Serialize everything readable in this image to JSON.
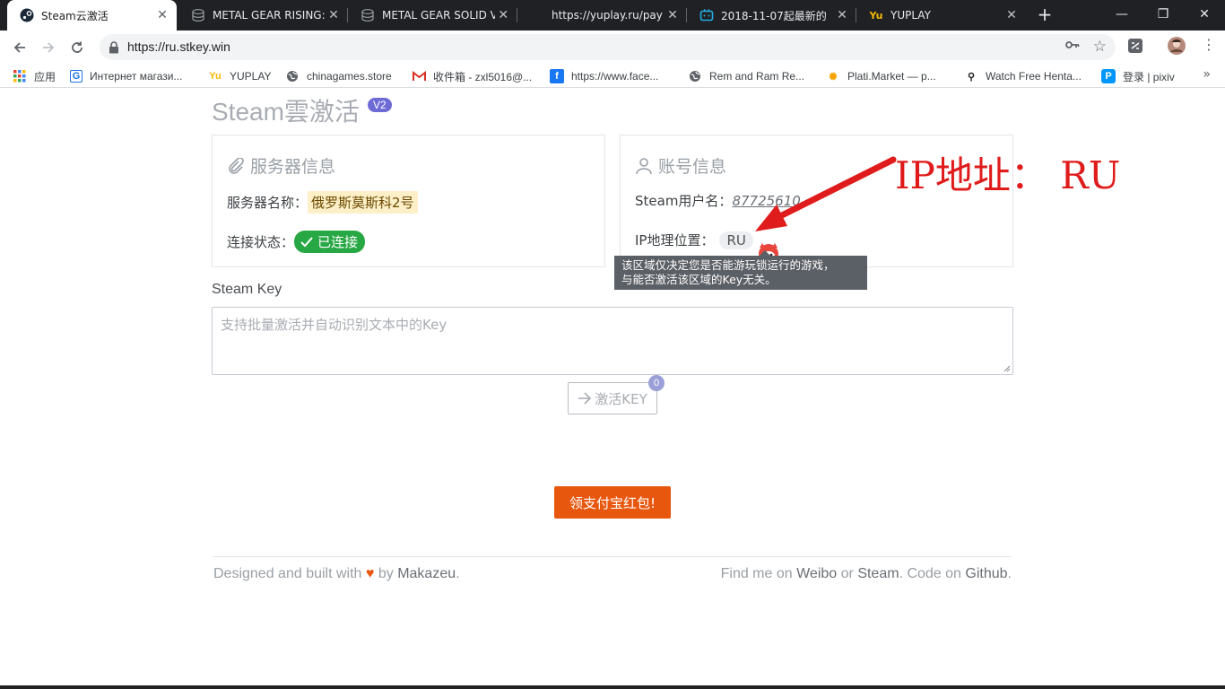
{
  "browser": {
    "tabs": [
      {
        "title": "Steam云激活",
        "active": true,
        "icon": "steam-icon"
      },
      {
        "title": "METAL GEAR RISING:",
        "active": false,
        "icon": "stack-icon"
      },
      {
        "title": "METAL GEAR SOLID V",
        "active": false,
        "icon": "stack-icon"
      },
      {
        "title": "https://yuplay.ru/pay",
        "active": false,
        "icon": "none"
      },
      {
        "title": "2018-11-07起最新的",
        "active": false,
        "icon": "bilibili-icon"
      },
      {
        "title": "YUPLAY",
        "active": false,
        "icon": "yuplay-icon"
      }
    ],
    "close_glyph": "✕",
    "new_tab_glyph": "+",
    "window_controls": {
      "minimize": "—",
      "maximize": "❐",
      "close": "✕"
    },
    "url": "https://ru.stkey.win",
    "bookmarks": [
      {
        "label": "应用",
        "icon": "apps-icon"
      },
      {
        "label": "Интернет магази...",
        "icon": "g-icon"
      },
      {
        "label": "YUPLAY",
        "icon": "yuplay-icon"
      },
      {
        "label": "chinagames.store",
        "icon": "globe-icon"
      },
      {
        "label": "收件箱 - zxl5016@...",
        "icon": "gmail-icon"
      },
      {
        "label": "https://www.face...",
        "icon": "facebook-icon"
      },
      {
        "label": "Rem and Ram Re...",
        "icon": "globe-icon"
      },
      {
        "label": "Plati.Market — p...",
        "icon": "plati-icon"
      },
      {
        "label": "Watch Free Henta...",
        "icon": "figure-icon"
      },
      {
        "label": "登录 | pixiv",
        "icon": "pixiv-icon"
      }
    ],
    "bookmarks_more": "»"
  },
  "page": {
    "brand": "Steam雲激活",
    "version_badge": "V2",
    "server_panel": {
      "title": "服务器信息",
      "name_label": "服务器名称：",
      "name_value": "俄罗斯莫斯科2号",
      "status_label": "连接状态：",
      "status_value": "已连接"
    },
    "account_panel": {
      "title": "账号信息",
      "username_label": "Steam用户名：",
      "username_value": "87725610",
      "ip_label": "IP地理位置：",
      "ip_value": "RU"
    },
    "tooltip": {
      "line1": "该区域仅决定您是否能游玩锁运行的游戏，",
      "line2": "与能否激活该区域的Key无关。"
    },
    "annotation": "IP地址： RU",
    "steam_key": {
      "label": "Steam Key",
      "placeholder": "支持批量激活并自动识别文本中的Key"
    },
    "activate_button": "激活KEY",
    "activate_count": "0",
    "alipay_button": "领支付宝红包!",
    "footer": {
      "left_prefix": "Designed and built with",
      "heart": "♥",
      "by": "by",
      "author": "Makazeu",
      "dot": ".",
      "right_prefix": "Find me on",
      "weibo": "Weibo",
      "or": "or",
      "steam": "Steam",
      "code_on": ". Code on",
      "github": "Github",
      "end_dot": "."
    },
    "colors": {
      "accent_orange": "#e8570e",
      "success_green": "#28a745",
      "annotation_red": "#e01b1b",
      "badge_purple": "#6f6bd6"
    }
  }
}
